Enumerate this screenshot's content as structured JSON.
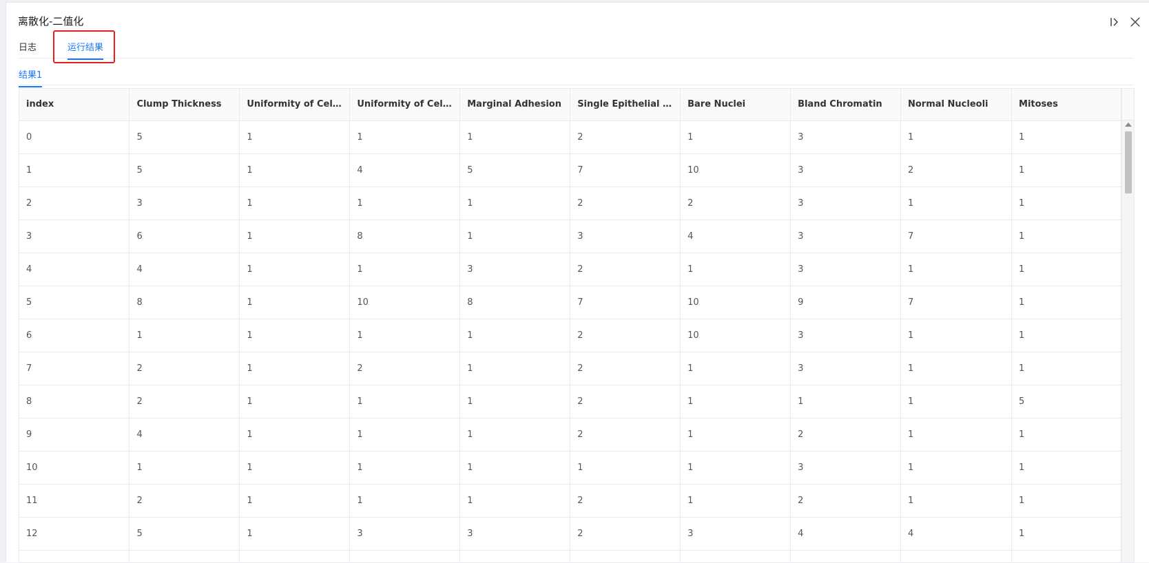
{
  "dialog": {
    "title": "离散化-二值化"
  },
  "tabs": [
    {
      "label": "日志"
    },
    {
      "label": "运行结果"
    }
  ],
  "subtabs": [
    {
      "label": "结果1"
    }
  ],
  "table": {
    "columns": [
      "index",
      "Clump Thickness",
      "Uniformity of Cell ...",
      "Uniformity of Cell ...",
      "Marginal Adhesion",
      "Single Epithelial C...",
      "Bare Nuclei",
      "Bland Chromatin",
      "Normal Nucleoli",
      "Mitoses"
    ],
    "rows": [
      [
        "0",
        "5",
        "1",
        "1",
        "1",
        "2",
        "1",
        "3",
        "1",
        "1"
      ],
      [
        "1",
        "5",
        "1",
        "4",
        "5",
        "7",
        "10",
        "3",
        "2",
        "1"
      ],
      [
        "2",
        "3",
        "1",
        "1",
        "1",
        "2",
        "2",
        "3",
        "1",
        "1"
      ],
      [
        "3",
        "6",
        "1",
        "8",
        "1",
        "3",
        "4",
        "3",
        "7",
        "1"
      ],
      [
        "4",
        "4",
        "1",
        "1",
        "3",
        "2",
        "1",
        "3",
        "1",
        "1"
      ],
      [
        "5",
        "8",
        "1",
        "10",
        "8",
        "7",
        "10",
        "9",
        "7",
        "1"
      ],
      [
        "6",
        "1",
        "1",
        "1",
        "1",
        "2",
        "10",
        "3",
        "1",
        "1"
      ],
      [
        "7",
        "2",
        "1",
        "2",
        "1",
        "2",
        "1",
        "3",
        "1",
        "1"
      ],
      [
        "8",
        "2",
        "1",
        "1",
        "1",
        "2",
        "1",
        "1",
        "1",
        "5"
      ],
      [
        "9",
        "4",
        "1",
        "1",
        "1",
        "2",
        "1",
        "2",
        "1",
        "1"
      ],
      [
        "10",
        "1",
        "1",
        "1",
        "1",
        "1",
        "1",
        "3",
        "1",
        "1"
      ],
      [
        "11",
        "2",
        "1",
        "1",
        "1",
        "2",
        "1",
        "2",
        "1",
        "1"
      ],
      [
        "12",
        "5",
        "1",
        "3",
        "3",
        "2",
        "3",
        "4",
        "4",
        "1"
      ],
      [
        "",
        "",
        "",
        "",
        "",
        "",
        "",
        "",
        "",
        ""
      ]
    ]
  },
  "colors": {
    "accent": "#1677ff",
    "highlight": "#e81e1e"
  }
}
